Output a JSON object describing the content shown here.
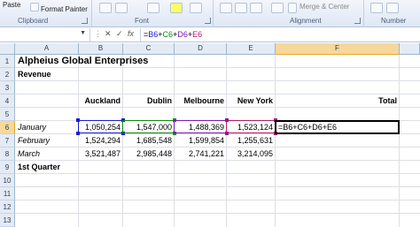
{
  "ribbon": {
    "paste_label": "Paste",
    "format_painter_label": "Format Painter",
    "merge_center_label": "Merge & Center",
    "groups": {
      "clipboard": "Clipboard",
      "font": "Font",
      "alignment": "Alignment",
      "number": "Number"
    }
  },
  "formula_bar": {
    "name_box": "",
    "cancel_symbol": "✕",
    "enter_symbol": "✓",
    "fx_label": "fx",
    "formula_parts": [
      "=",
      "B6",
      "+",
      "C6",
      "+",
      "D6",
      "+",
      "E6"
    ]
  },
  "columns": [
    "A",
    "B",
    "C",
    "D",
    "E",
    "F"
  ],
  "active_column": "F",
  "active_row": "6",
  "rows": [
    "1",
    "2",
    "3",
    "4",
    "5",
    "6",
    "7",
    "8",
    "9",
    "10",
    "11",
    "12",
    "13"
  ],
  "sheet": {
    "title": "Alpheius Global Enterprises",
    "subtitle": "Revenue",
    "headers": {
      "auckland": "Auckland",
      "dublin": "Dublin",
      "melbourne": "Melbourne",
      "new_york": "New York",
      "total": "Total"
    },
    "data_rows": [
      {
        "label": "January",
        "values": [
          "1,050,254",
          "1,547,000",
          "1,488,369",
          "1,523,124"
        ],
        "total": "=B6+C6+D6+E6"
      },
      {
        "label": "February",
        "values": [
          "1,524,294",
          "1,685,548",
          "1,599,854",
          "1,255,631"
        ],
        "total": ""
      },
      {
        "label": "March",
        "values": [
          "3,521,487",
          "2,985,448",
          "2,741,221",
          "3,214,095"
        ],
        "total": ""
      }
    ],
    "quarter_label": "1st Quarter"
  },
  "colors": {
    "ref_b6": "#1b1bd6",
    "ref_c6": "#0b8a0b",
    "ref_d6": "#7a17b3",
    "ref_e6": "#b21a6a",
    "header_active": "#f7d89a"
  }
}
